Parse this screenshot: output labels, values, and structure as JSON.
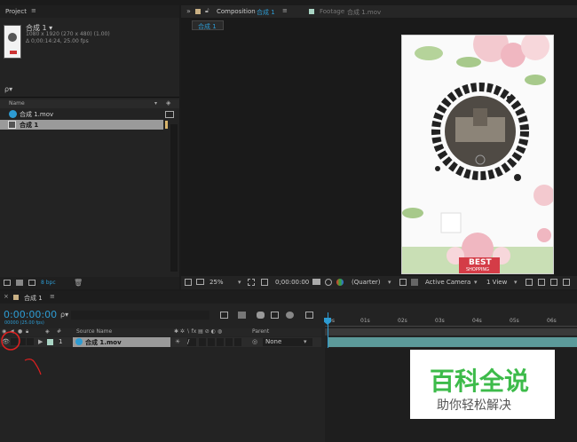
{
  "project": {
    "tab": "Project",
    "menu": "≡",
    "comp_name": "合成 1 ▾",
    "comp_info1": "1080 x 1920  (270 x 480) (1.00)",
    "comp_info2": "Δ 0;00:14:24, 25.00 fps",
    "search_placeholder": "ρ▾",
    "col_name": "Name",
    "items": [
      {
        "name": "合成 1.mov"
      },
      {
        "name": "合成 1"
      }
    ],
    "bpc": "8 bpc"
  },
  "viewer": {
    "tab_arrows": "»",
    "tab1_label": "Composition",
    "tab1_comp": "合成 1",
    "tab2_label": "Footage",
    "tab2_file": "合成 1.mov",
    "subtab": "合成 1",
    "zoom": "25%",
    "timecode": "0;00:00:00",
    "resolution": "(Quarter)",
    "camera": "Active Camera",
    "views": "1 View",
    "poster_text": "BEST",
    "poster_sub": "SHOPPING"
  },
  "timeline": {
    "tab_label": "合成 1",
    "timecode": "0:00:00:00",
    "fps": "00000 (25.00 fps)",
    "search_placeholder": "ρ▾",
    "col_num": "#",
    "col_source": "Source Name",
    "col_parent": "Parent",
    "layer_num": "1",
    "layer_name": "合成 1.mov",
    "parent_value": "None",
    "ruler": [
      "0s",
      "01s",
      "02s",
      "03s",
      "04s",
      "05s",
      "06s"
    ]
  },
  "watermark": {
    "title": "百科全说",
    "subtitle": "助你轻松解决"
  },
  "colors": {
    "accent_blue": "#2d9bd2",
    "watermark_green": "#3dbb4a",
    "layer_bar": "#5c9a9a"
  }
}
